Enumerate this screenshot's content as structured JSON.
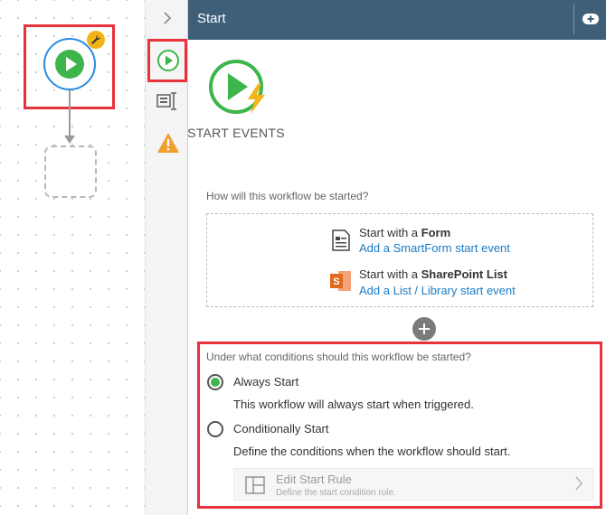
{
  "panel": {
    "title": "Start",
    "hero_label": "START EVENTS"
  },
  "events": {
    "question": "How will this workflow be started?",
    "form": {
      "title_prefix": "Start with a ",
      "title_bold": "Form",
      "link": "Add a SmartForm start event"
    },
    "sharepoint": {
      "title_prefix": "Start with a ",
      "title_bold": "SharePoint List",
      "link": "Add a List / Library start event"
    }
  },
  "conditions": {
    "question": "Under what conditions should this workflow be started?",
    "options": [
      {
        "label": "Always Start",
        "description": "This workflow will always start when triggered.",
        "selected": true
      },
      {
        "label": "Conditionally Start",
        "description": "Define the conditions when the workflow should start.",
        "selected": false
      }
    ],
    "rule": {
      "title": "Edit Start Rule",
      "subtitle": "Define the start condition rule."
    }
  },
  "colors": {
    "header_bg": "#3f5f79",
    "accent_green": "#3db54a",
    "link_blue": "#1a7cc6",
    "highlight_red": "#e8323c",
    "node_blue": "#2a8be0"
  },
  "icons": [
    "play-icon",
    "wrench-icon",
    "chevron-right-icon",
    "form-properties-icon",
    "warning-icon",
    "add-icon",
    "lightning-icon",
    "form-icon",
    "sharepoint-icon",
    "rule-layout-icon"
  ]
}
